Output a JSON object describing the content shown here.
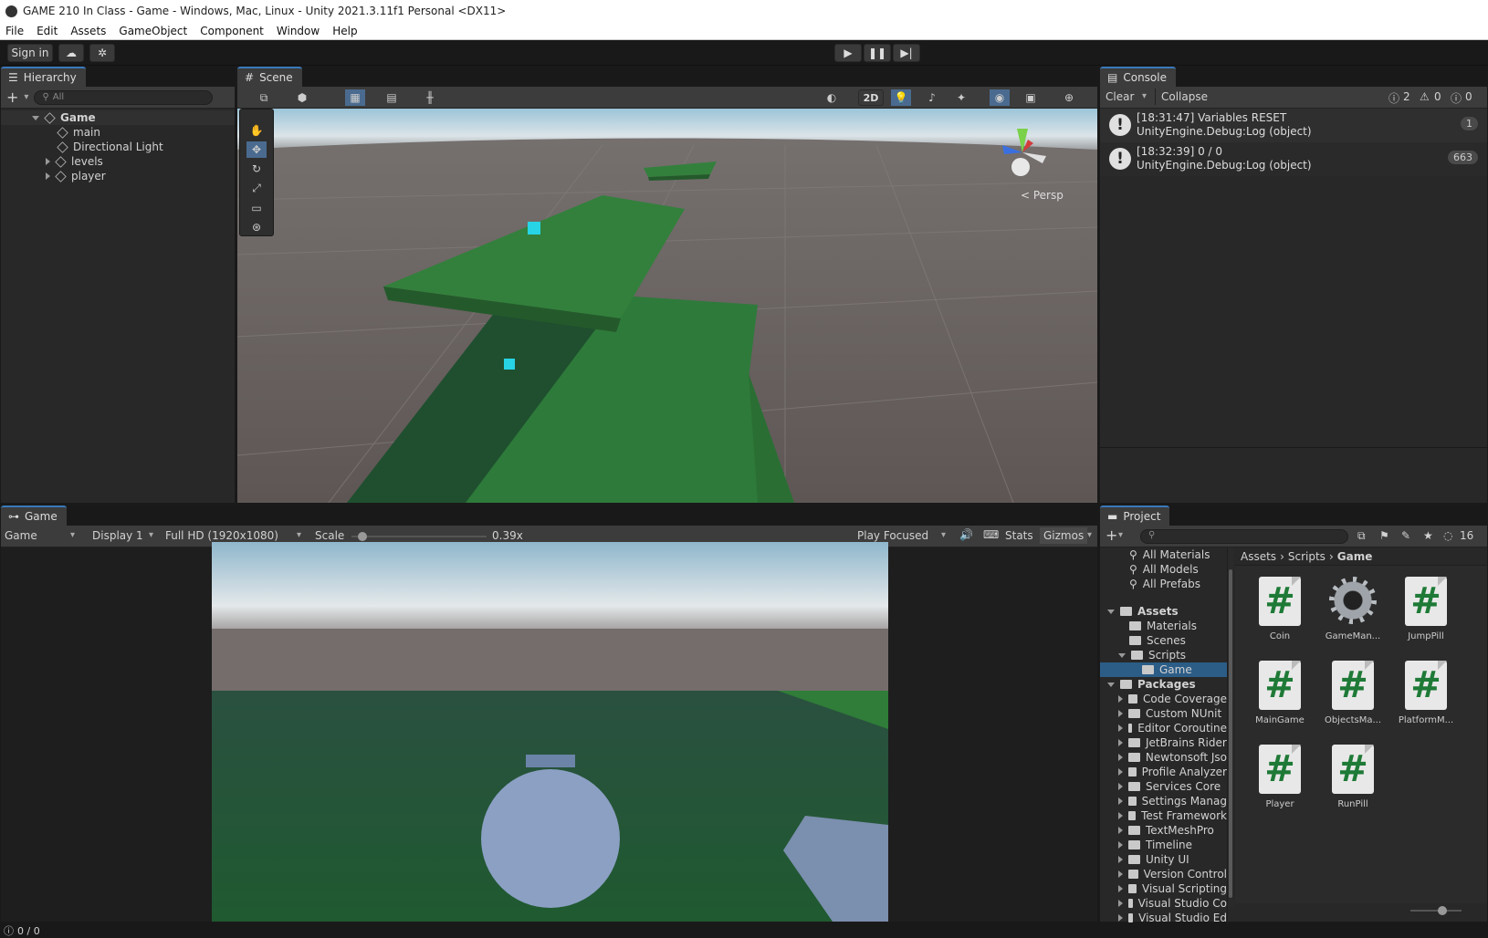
{
  "title": "GAME 210 In Class - Game - Windows, Mac, Linux - Unity 2021.3.11f1 Personal <DX11>",
  "menu": [
    "File",
    "Edit",
    "Assets",
    "GameObject",
    "Component",
    "Window",
    "Help"
  ],
  "toolbar": {
    "signin": "Sign in"
  },
  "hierarchy": {
    "tab": "Hierarchy",
    "search_placeholder": "All",
    "scene": "Game",
    "items": [
      "main",
      "Directional Light",
      "levels",
      "player"
    ]
  },
  "scene_view": {
    "tab": "Scene",
    "mode_2d": "2D",
    "persp": "< Persp"
  },
  "console": {
    "tab": "Console",
    "clear": "Clear",
    "collapse": "Collapse",
    "info_count": "2",
    "warn_count": "0",
    "error_count": "0",
    "logs": [
      {
        "line1": "[18:31:47] Variables RESET",
        "line2": "UnityEngine.Debug:Log (object)",
        "count": "1"
      },
      {
        "line1": "[18:32:39] 0 / 0",
        "line2": "UnityEngine.Debug:Log (object)",
        "count": "663"
      }
    ]
  },
  "game_view": {
    "tab": "Game",
    "view": "Game",
    "display": "Display 1",
    "resolution": "Full HD (1920x1080)",
    "scale_label": "Scale",
    "scale_value": "0.39x",
    "scale_fraction": 0.05,
    "play_mode": "Play Focused",
    "stats": "Stats",
    "gizmos": "Gizmos"
  },
  "project": {
    "tab": "Project",
    "hidden_count": "16",
    "favorites": [
      "All Materials",
      "All Models",
      "All Prefabs"
    ],
    "assets_root": "Assets",
    "asset_folders": [
      "Materials",
      "Scenes",
      "Scripts"
    ],
    "scripts_sub": "Game",
    "packages_root": "Packages",
    "packages": [
      "Code Coverage",
      "Custom NUnit",
      "Editor Coroutine",
      "JetBrains Rider",
      "Newtonsoft Jso",
      "Profile Analyzer",
      "Services Core",
      "Settings Manag",
      "Test Framework",
      "TextMeshPro",
      "Timeline",
      "Unity UI",
      "Version Control",
      "Visual Scripting",
      "Visual Studio Co",
      "Visual Studio Ed"
    ],
    "breadcrumb": [
      "Assets",
      "Scripts",
      "Game"
    ],
    "files": [
      {
        "name": "Coin",
        "type": "script"
      },
      {
        "name": "GameMan...",
        "type": "gear"
      },
      {
        "name": "JumpPill",
        "type": "script"
      },
      {
        "name": "MainGame",
        "type": "script"
      },
      {
        "name": "ObjectsMa...",
        "type": "script"
      },
      {
        "name": "PlatformM...",
        "type": "script"
      },
      {
        "name": "Player",
        "type": "script"
      },
      {
        "name": "RunPill",
        "type": "script"
      }
    ]
  },
  "status": {
    "text": "0 / 0"
  }
}
